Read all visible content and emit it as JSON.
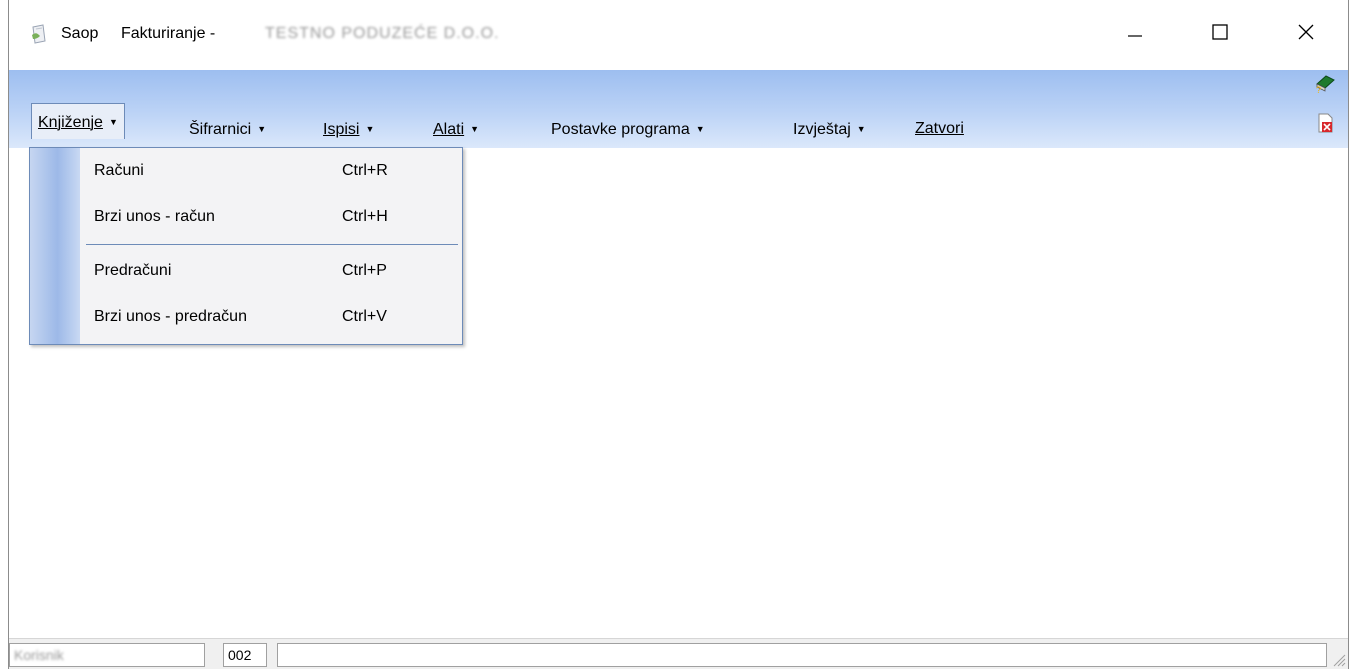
{
  "titlebar": {
    "app_name": "Saop",
    "module": "Fakturiranje -",
    "company": "TESTNO PODUZEĆE D.O.O.",
    "app_icon": "saop-app-icon",
    "minimize_icon": "minimize-icon",
    "maximize_icon": "maximize-icon",
    "close_icon": "close-icon"
  },
  "menu": {
    "items": [
      {
        "label": "Knjiženje",
        "has_arrow": true,
        "active": true
      },
      {
        "label": "Šifrarnici",
        "has_arrow": true
      },
      {
        "label": "Ispisi",
        "has_arrow": true
      },
      {
        "label": "Alati",
        "has_arrow": true
      },
      {
        "label": "Postavke programa",
        "has_arrow": true
      },
      {
        "label": "Izvještaj",
        "has_arrow": true
      },
      {
        "label": "Zatvori",
        "has_arrow": false
      }
    ],
    "arrow": "▼",
    "help_icon": "help-book-icon",
    "exit_icon": "exit-document-icon"
  },
  "dropdown": {
    "items": [
      {
        "label": "Računi",
        "shortcut": "Ctrl+R"
      },
      {
        "label": "Brzi unos - račun",
        "shortcut": "Ctrl+H"
      },
      {
        "label": "Predračuni",
        "shortcut": "Ctrl+P"
      },
      {
        "label": "Brzi unos - predračun",
        "shortcut": "Ctrl+V"
      }
    ]
  },
  "statusbar": {
    "user": "Korisnik",
    "code": "002",
    "message": ""
  },
  "colors": {
    "menubar_top": "#9dbef0",
    "menubar_bottom": "#dbe8fb",
    "dropdown_border": "#6d8bb8"
  }
}
